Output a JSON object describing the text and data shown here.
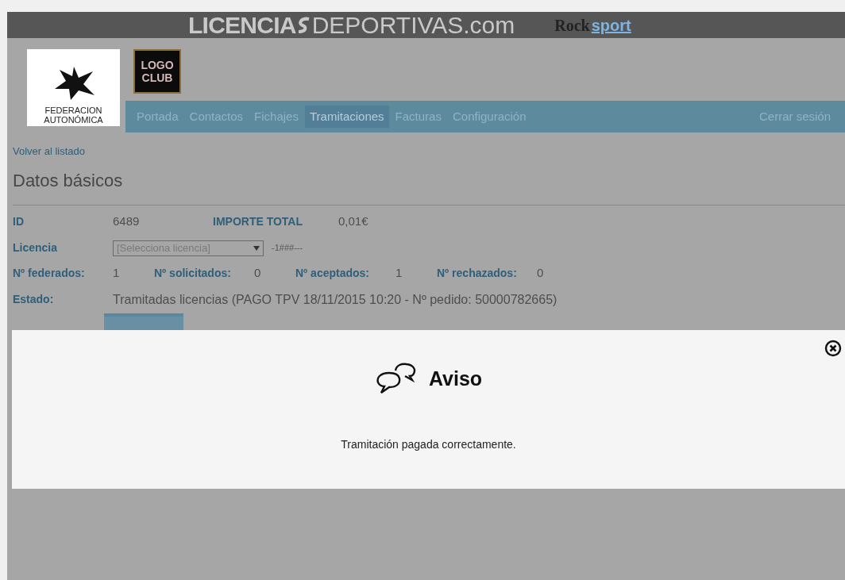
{
  "header": {
    "brand_bold": "LICENCIA",
    "brand_light": "DEPORTIVAS.com",
    "partner_dark": "Rock",
    "partner_blue": "sport"
  },
  "federation": {
    "line1": "FEDERACION",
    "line2": "AUTONÓMICA"
  },
  "club_logo": {
    "line1": "LOGO",
    "line2": "CLUB"
  },
  "nav": {
    "items": [
      {
        "label": "Portada",
        "selected": false
      },
      {
        "label": "Contactos",
        "selected": false
      },
      {
        "label": "Fichajes",
        "selected": false
      },
      {
        "label": "Tramitaciones",
        "selected": true
      },
      {
        "label": "Facturas",
        "selected": false
      },
      {
        "label": "Configuración",
        "selected": false
      }
    ],
    "logout": "Cerrar sesión"
  },
  "back_link": "Volver al listado",
  "section_title": "Datos básicos",
  "fields": {
    "id_label": "ID",
    "id_value": "6489",
    "total_label": "IMPORTE TOTAL",
    "total_value": "0,01€",
    "licence_label": "Licencia",
    "licence_select": "[Selecciona licencia]",
    "licence_code": "-1###---",
    "counts": [
      {
        "label": "Nº federados:",
        "value": "1"
      },
      {
        "label": "Nº solicitados:",
        "value": "0"
      },
      {
        "label": "Nº aceptados:",
        "value": "1"
      },
      {
        "label": "Nº rechazados:",
        "value": "0"
      }
    ],
    "state_label": "Estado:",
    "state_value": "Tramitadas licencias (PAGO TPV 18/11/2015 10:20 - Nº pedido: 50000782665)"
  },
  "modal": {
    "title": "Aviso",
    "message": "Tramitación pagada correctamente."
  }
}
